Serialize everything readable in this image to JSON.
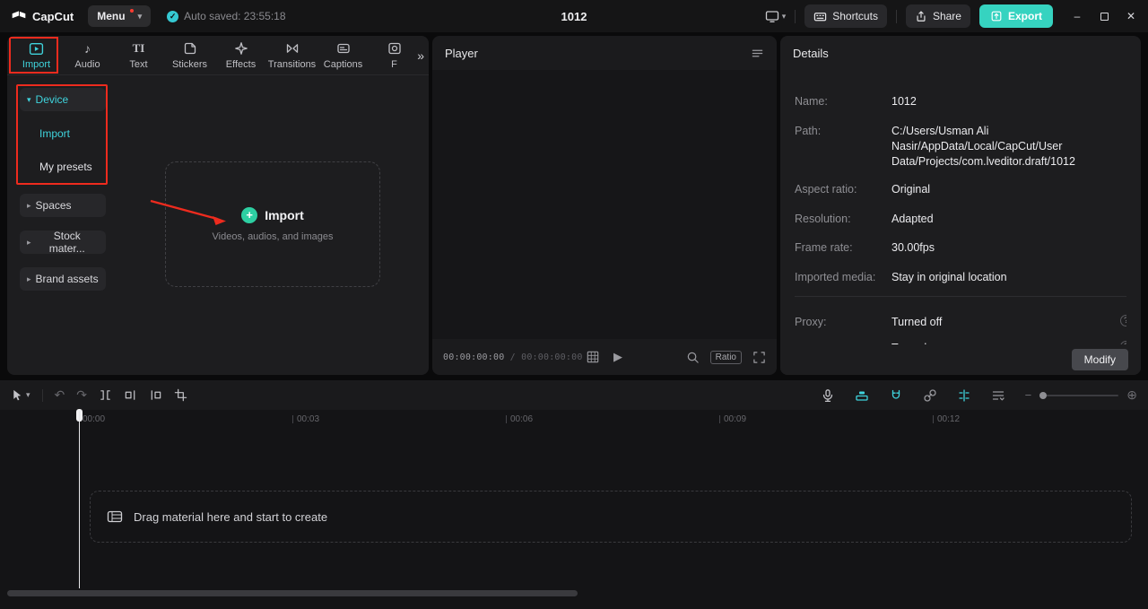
{
  "colors": {
    "accent_cyan": "#3fd3dc",
    "export_teal": "#36d3c0",
    "import_plus_green": "#2dcfa2",
    "annotation_red": "#ee2b1e"
  },
  "icons": {
    "caret_down": "▾",
    "caret_right": "▸",
    "chevron_double": "»",
    "check": "✓",
    "audio_note": "♪",
    "text_glyph": "TI",
    "plus": "+",
    "undo": "↶",
    "redo": "↷",
    "play": "▶",
    "question": "?",
    "minus": "−",
    "plus_circled": "⊕",
    "minimize": "–",
    "close": "✕"
  },
  "topbar": {
    "logo_text": "CapCut",
    "menu_label": "Menu",
    "autosave_text": "Auto saved: 23:55:18",
    "project_title": "1012",
    "shortcuts_label": "Shortcuts",
    "share_label": "Share",
    "export_label": "Export"
  },
  "media_panel": {
    "tabs": [
      {
        "label": "Import"
      },
      {
        "label": "Audio"
      },
      {
        "label": "Text"
      },
      {
        "label": "Stickers"
      },
      {
        "label": "Effects"
      },
      {
        "label": "Transitions"
      },
      {
        "label": "Captions"
      },
      {
        "label": "F"
      }
    ],
    "nav": {
      "device_label": "Device",
      "device_children": [
        {
          "label": "Import"
        },
        {
          "label": "My presets"
        }
      ],
      "collapsed": [
        {
          "label": "Spaces"
        },
        {
          "label": "Stock mater..."
        },
        {
          "label": "Brand assets"
        }
      ]
    },
    "dropzone": {
      "title": "Import",
      "subtitle": "Videos, audios, and images"
    }
  },
  "player": {
    "title": "Player",
    "time_current": "00:00:00:00",
    "time_separator": " / ",
    "time_total": "00:00:00:00",
    "ratio_label": "Ratio"
  },
  "details": {
    "title": "Details",
    "rows": [
      {
        "label": "Name:",
        "value": "1012"
      },
      {
        "label": "Path:",
        "value": "C:/Users/Usman Ali Nasir/AppData/Local/CapCut/User Data/Projects/com.lveditor.draft/1012"
      },
      {
        "label": "Aspect ratio:",
        "value": "Original"
      },
      {
        "label": "Resolution:",
        "value": "Adapted"
      },
      {
        "label": "Frame rate:",
        "value": "30.00fps"
      },
      {
        "label": "Imported media:",
        "value": "Stay in original location"
      }
    ],
    "proxy_row": {
      "label": "Proxy:",
      "value": "Turned off"
    },
    "clipped_row": {
      "label": "",
      "value": "Turned"
    },
    "modify_label": "Modify"
  },
  "timeline": {
    "ruler": [
      "00:00",
      "00:03",
      "00:06",
      "00:09",
      "00:12"
    ],
    "drop_hint": "Drag material here and start to create"
  }
}
